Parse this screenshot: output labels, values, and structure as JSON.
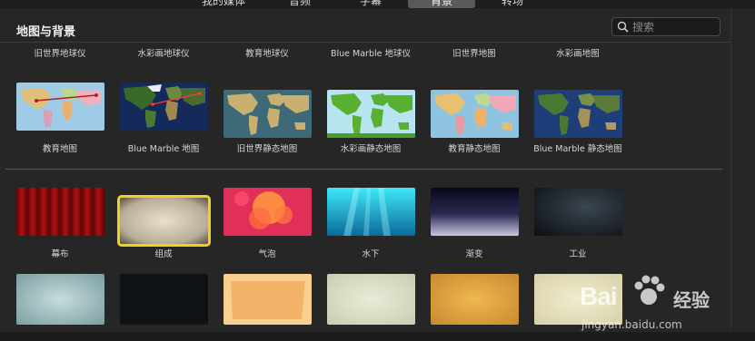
{
  "tabs": [
    {
      "label": "我的媒体"
    },
    {
      "label": "音频"
    },
    {
      "label": "字幕"
    },
    {
      "label": "背景"
    },
    {
      "label": "转场"
    }
  ],
  "section": {
    "title": "地图与背景"
  },
  "search": {
    "placeholder": "搜索",
    "value": ""
  },
  "row1_captions": [
    "旧世界地球仪",
    "水彩画地球仪",
    "教育地球仪",
    "Blue Marble 地球仪",
    "旧世界地图",
    "水彩画地图"
  ],
  "row2": [
    {
      "label": "教育地图"
    },
    {
      "label": "Blue Marble 地图"
    },
    {
      "label": "旧世界静态地图"
    },
    {
      "label": "水彩画静态地图"
    },
    {
      "label": "教育静态地图"
    },
    {
      "label": "Blue Marble 静态地图"
    }
  ],
  "row3": [
    {
      "label": "幕布"
    },
    {
      "label": "组成"
    },
    {
      "label": "气泡"
    },
    {
      "label": "水下"
    },
    {
      "label": "渐变"
    },
    {
      "label": "工业"
    }
  ],
  "selected_item": "组成",
  "watermark": {
    "brand": "Bai",
    "brand2": "经验",
    "url": "jingyan.baidu.com"
  },
  "colors": {
    "selection": "#f0d21e",
    "panel": "#262626"
  }
}
